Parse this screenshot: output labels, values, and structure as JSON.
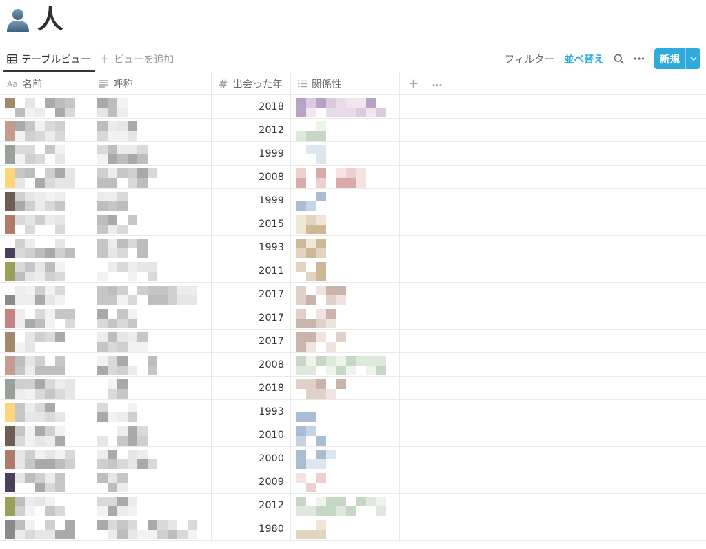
{
  "page": {
    "title": "人",
    "icon": "person-silhouette-icon"
  },
  "view_bar": {
    "active_view": "テーブルビュー",
    "add_view": "ビューを追加",
    "filter": "フィルター",
    "sort": "並べ替え",
    "new_button": "新規"
  },
  "table": {
    "columns": [
      {
        "label": "名前",
        "icon": "Aa"
      },
      {
        "label": "呼称",
        "icon": "text-lines-icon"
      },
      {
        "label": "出会った年",
        "icon": "#"
      },
      {
        "label": "関係性",
        "icon": "list-icon"
      }
    ],
    "rows": [
      {
        "year": "2018"
      },
      {
        "year": "2012"
      },
      {
        "year": "1999"
      },
      {
        "year": "2008"
      },
      {
        "year": "1999"
      },
      {
        "year": "2015"
      },
      {
        "year": "1993"
      },
      {
        "year": "2011"
      },
      {
        "year": "2017"
      },
      {
        "year": "2017"
      },
      {
        "year": "2017"
      },
      {
        "year": "2008"
      },
      {
        "year": "2018"
      },
      {
        "year": "1993"
      },
      {
        "year": "2010"
      },
      {
        "year": "2000"
      },
      {
        "year": "2009"
      },
      {
        "year": "2012"
      },
      {
        "year": "1980"
      }
    ]
  },
  "colors": {
    "accent": "#2eaadc",
    "grid": "#e9e9e7",
    "text": "#37352f",
    "muted": "#9b9a97"
  }
}
